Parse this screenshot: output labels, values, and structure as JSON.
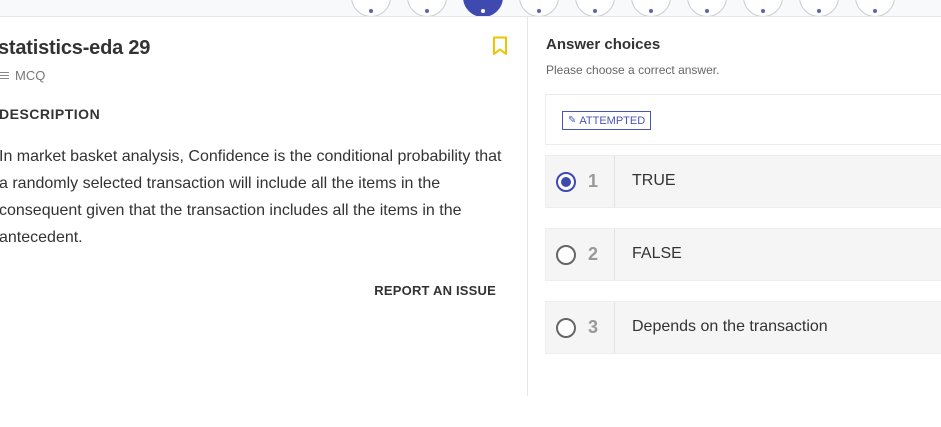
{
  "navigator": {
    "dots": [
      {
        "state": "default"
      },
      {
        "state": "default"
      },
      {
        "state": "active"
      },
      {
        "state": "default"
      },
      {
        "state": "default"
      },
      {
        "state": "default"
      },
      {
        "state": "default"
      },
      {
        "state": "default"
      },
      {
        "state": "default"
      },
      {
        "state": "default"
      }
    ]
  },
  "question": {
    "title": "statistics-eda 29",
    "type": "MCQ",
    "section_label": "DESCRIPTION",
    "description": "In market basket analysis, Confidence is the conditional probability that a randomly selected transaction will include all the items in the consequent given that the transaction includes all the items in the antecedent.",
    "report_label": "REPORT AN ISSUE",
    "bookmark_icon": "bookmark-icon"
  },
  "answers": {
    "title": "Answer choices",
    "hint": "Please choose a correct answer.",
    "status": "ATTEMPTED",
    "choices": [
      {
        "num": "1",
        "text": "TRUE",
        "selected": true
      },
      {
        "num": "2",
        "text": "FALSE",
        "selected": false
      },
      {
        "num": "3",
        "text": "Depends on the transaction",
        "selected": false
      }
    ]
  },
  "colors": {
    "accent": "#3f4ab0",
    "bookmark": "#f2c200",
    "text": "#333333"
  }
}
